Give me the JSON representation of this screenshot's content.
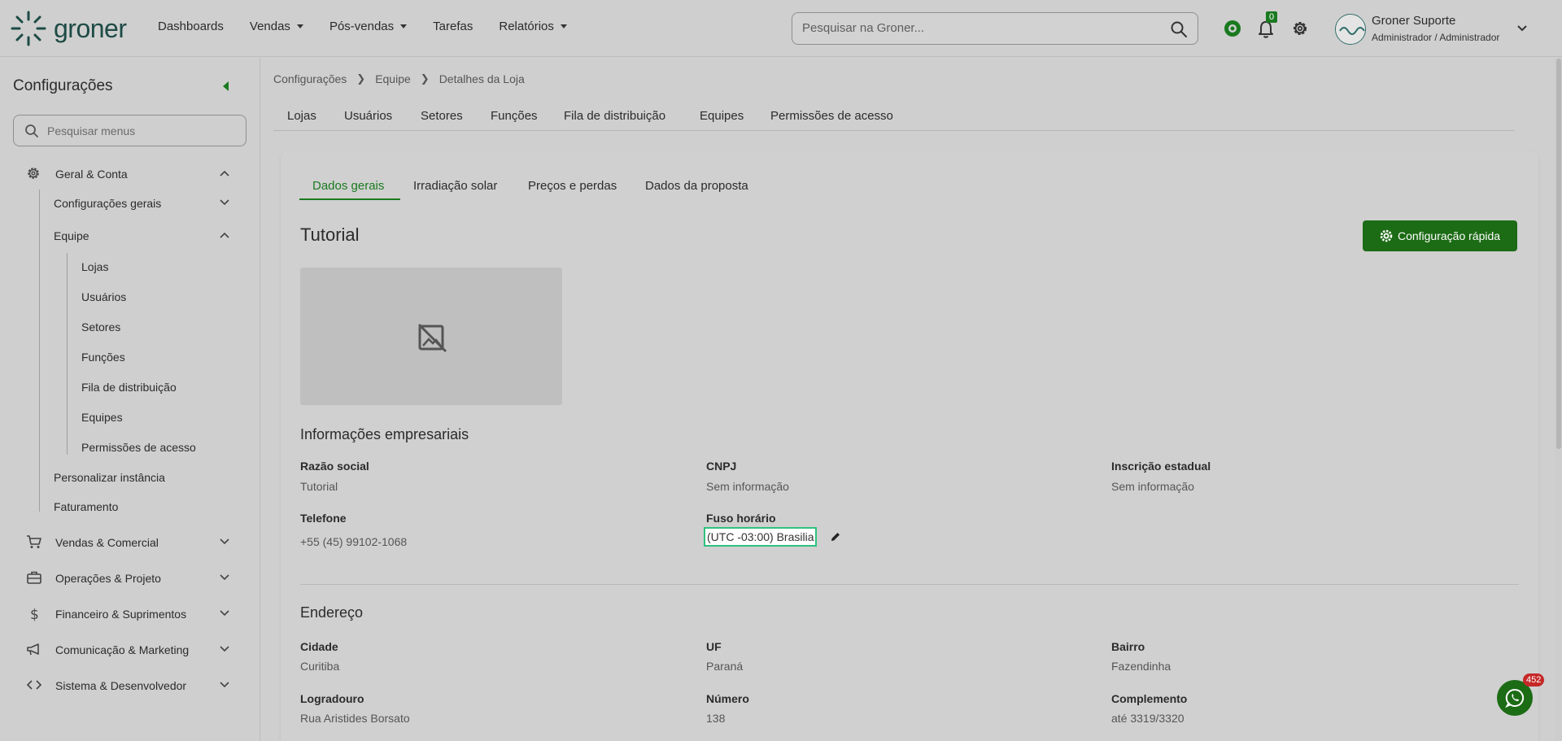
{
  "app": {
    "logo_text": "groner",
    "brand_color": "#1d4b45",
    "accent_color": "#1a7a20"
  },
  "topnav": {
    "items": [
      {
        "label": "Dashboards",
        "has_dropdown": false
      },
      {
        "label": "Vendas",
        "has_dropdown": true
      },
      {
        "label": "Pós-vendas",
        "has_dropdown": true
      },
      {
        "label": "Tarefas",
        "has_dropdown": false
      },
      {
        "label": "Relatórios",
        "has_dropdown": true
      }
    ]
  },
  "search": {
    "placeholder": "Pesquisar na Groner..."
  },
  "header": {
    "notifications_count": "0",
    "icons": [
      "chat-bot-icon",
      "bell-icon",
      "gear-icon"
    ]
  },
  "user": {
    "name": "Groner Suporte",
    "role": "Administrador / Administrador"
  },
  "sidebar": {
    "title": "Configurações",
    "search_placeholder": "Pesquisar menus",
    "sections": [
      {
        "label": "Geral & Conta",
        "icon": "gear-icon",
        "expanded": true
      },
      {
        "label": "Vendas & Comercial",
        "icon": "cart-icon",
        "expanded": false
      },
      {
        "label": "Operações & Projeto",
        "icon": "toolbox-icon",
        "expanded": false
      },
      {
        "label": "Financeiro & Suprimentos",
        "icon": "dollar-icon",
        "expanded": false
      },
      {
        "label": "Comunicação & Marketing",
        "icon": "megaphone-icon",
        "expanded": false
      },
      {
        "label": "Sistema & Desenvolvedor",
        "icon": "code-icon",
        "expanded": false
      }
    ],
    "geral_children": [
      {
        "label": "Configurações gerais",
        "expandable": true,
        "expanded": false
      },
      {
        "label": "Equipe",
        "expandable": true,
        "expanded": true
      },
      {
        "label": "Personalizar instância",
        "expandable": false
      },
      {
        "label": "Faturamento",
        "expandable": false
      }
    ],
    "equipe_children": [
      "Lojas",
      "Usuários",
      "Setores",
      "Funções",
      "Fila de distribuição",
      "Equipes",
      "Permissões de acesso"
    ]
  },
  "breadcrumb": [
    "Configurações",
    "Equipe",
    "Detalhes da Loja"
  ],
  "tabs_top": [
    "Lojas",
    "Usuários",
    "Setores",
    "Funções",
    "Fila de distribuição",
    "Equipes",
    "Permissões de acesso"
  ],
  "tabs_inner": {
    "items": [
      "Dados gerais",
      "Irradiação solar",
      "Preços e perdas",
      "Dados da proposta"
    ],
    "active": "Dados gerais"
  },
  "store": {
    "title": "Tutorial",
    "quick_config_label": "Configuração rápida",
    "business_section_title": "Informações empresariais",
    "fields": {
      "razao_social": {
        "label": "Razão social",
        "value": "Tutorial"
      },
      "cnpj": {
        "label": "CNPJ",
        "value": "Sem informação"
      },
      "inscricao": {
        "label": "Inscrição estadual",
        "value": "Sem informação"
      },
      "telefone": {
        "label": "Telefone",
        "value": "+55 (45) 99102-1068"
      },
      "fuso": {
        "label": "Fuso horário",
        "value": "(UTC -03:00) Brasilia"
      }
    },
    "address_section_title": "Endereço",
    "address": {
      "cidade": {
        "label": "Cidade",
        "value": "Curitiba"
      },
      "uf": {
        "label": "UF",
        "value": "Paraná"
      },
      "bairro": {
        "label": "Bairro",
        "value": "Fazendinha"
      },
      "logradouro": {
        "label": "Logradouro",
        "value": "Rua Aristides Borsato"
      },
      "numero": {
        "label": "Número",
        "value": "138"
      },
      "complemento": {
        "label": "Complemento",
        "value": "até 3319/3320"
      }
    }
  },
  "whatsapp": {
    "badge": "452"
  }
}
